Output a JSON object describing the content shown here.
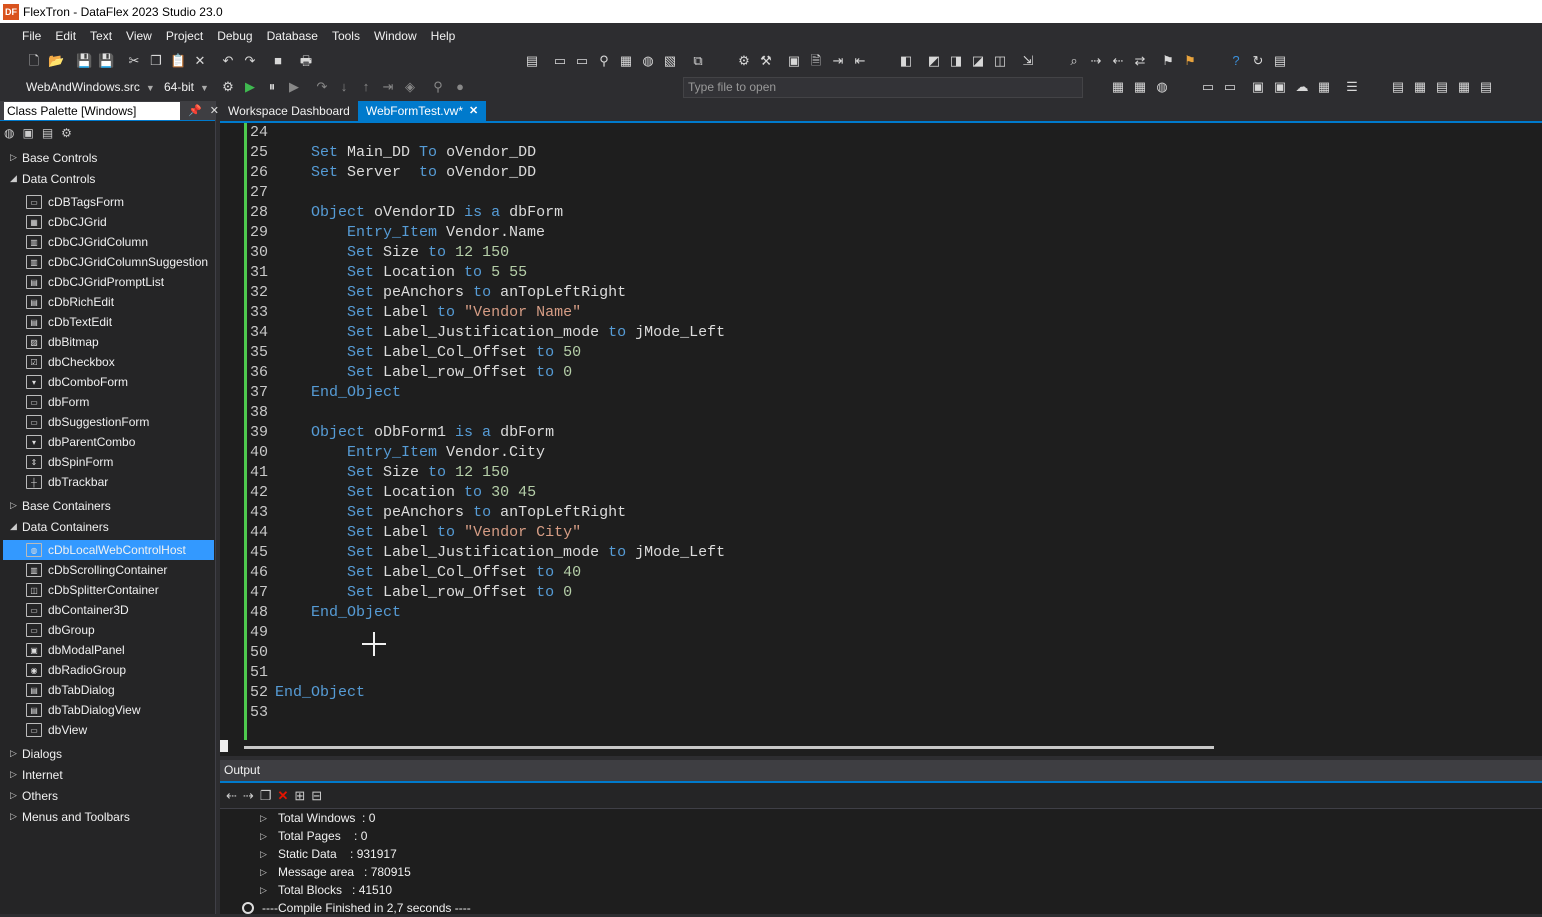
{
  "window": {
    "title": "FlexTron - DataFlex 2023 Studio 23.0",
    "app_icon": "DF"
  },
  "menu": [
    "File",
    "Edit",
    "Text",
    "View",
    "Project",
    "Debug",
    "Database",
    "Tools",
    "Window",
    "Help"
  ],
  "toolbar": {
    "workspace_combo": "WebAndWindows.src",
    "bitness_combo": "64-bit",
    "type_file_placeholder": "Type file to open"
  },
  "palette": {
    "title": "Class Palette [Windows]",
    "groups": [
      {
        "label": "Base Controls",
        "expanded": false
      },
      {
        "label": "Data Controls",
        "expanded": true,
        "items": [
          "cDBTagsForm",
          "cDbCJGrid",
          "cDbCJGridColumn",
          "cDbCJGridColumnSuggestion",
          "cDbCJGridPromptList",
          "cDbRichEdit",
          "cDbTextEdit",
          "dbBitmap",
          "dbCheckbox",
          "dbComboForm",
          "dbForm",
          "dbSuggestionForm",
          "dbParentCombo",
          "dbSpinForm",
          "dbTrackbar"
        ]
      },
      {
        "label": "Base Containers",
        "expanded": false
      },
      {
        "label": "Data Containers",
        "expanded": true,
        "items": [
          "cDbLocalWebControlHost",
          "cDbScrollingContainer",
          "cDbSplitterContainer",
          "dbContainer3D",
          "dbGroup",
          "dbModalPanel",
          "dbRadioGroup",
          "dbTabDialog",
          "dbTabDialogView",
          "dbView"
        ]
      },
      {
        "label": "Dialogs",
        "expanded": false
      },
      {
        "label": "Internet",
        "expanded": false
      },
      {
        "label": "Others",
        "expanded": false
      },
      {
        "label": "Menus and Toolbars",
        "expanded": false
      }
    ],
    "selected_item": "cDbLocalWebControlHost"
  },
  "tabs": [
    {
      "label": "Workspace Dashboard",
      "active": false
    },
    {
      "label": "WebFormTest.vw*",
      "active": true
    }
  ],
  "editor": {
    "lines": [
      {
        "n": "24",
        "tokens": []
      },
      {
        "n": "25",
        "tokens": [
          [
            "    ",
            "txt"
          ],
          [
            "Set",
            "kw"
          ],
          [
            " Main_DD ",
            "txt"
          ],
          [
            "To",
            "kw"
          ],
          [
            " oVendor_DD",
            "txt"
          ]
        ]
      },
      {
        "n": "26",
        "tokens": [
          [
            "    ",
            "txt"
          ],
          [
            "Set",
            "kw"
          ],
          [
            " Server  ",
            "txt"
          ],
          [
            "to",
            "kw"
          ],
          [
            " oVendor_DD",
            "txt"
          ]
        ]
      },
      {
        "n": "27",
        "tokens": []
      },
      {
        "n": "28",
        "tokens": [
          [
            "    ",
            "txt"
          ],
          [
            "Object",
            "kw"
          ],
          [
            " oVendorID ",
            "txt"
          ],
          [
            "is a",
            "kw"
          ],
          [
            " dbForm",
            "txt"
          ]
        ]
      },
      {
        "n": "29",
        "tokens": [
          [
            "        ",
            "txt"
          ],
          [
            "Entry_Item",
            "kw"
          ],
          [
            " Vendor.Name",
            "txt"
          ]
        ]
      },
      {
        "n": "30",
        "tokens": [
          [
            "        ",
            "txt"
          ],
          [
            "Set",
            "kw"
          ],
          [
            " Size ",
            "txt"
          ],
          [
            "to",
            "kw"
          ],
          [
            " 12 150",
            "num"
          ]
        ]
      },
      {
        "n": "31",
        "tokens": [
          [
            "        ",
            "txt"
          ],
          [
            "Set",
            "kw"
          ],
          [
            " Location ",
            "txt"
          ],
          [
            "to",
            "kw"
          ],
          [
            " 5 55",
            "num"
          ]
        ]
      },
      {
        "n": "32",
        "tokens": [
          [
            "        ",
            "txt"
          ],
          [
            "Set",
            "kw"
          ],
          [
            " peAnchors ",
            "txt"
          ],
          [
            "to",
            "kw"
          ],
          [
            " anTopLeftRight",
            "txt"
          ]
        ]
      },
      {
        "n": "33",
        "tokens": [
          [
            "        ",
            "txt"
          ],
          [
            "Set",
            "kw"
          ],
          [
            " Label ",
            "txt"
          ],
          [
            "to",
            "kw"
          ],
          [
            " \"Vendor Name\"",
            "str"
          ]
        ]
      },
      {
        "n": "34",
        "tokens": [
          [
            "        ",
            "txt"
          ],
          [
            "Set",
            "kw"
          ],
          [
            " Label_Justification_mode ",
            "txt"
          ],
          [
            "to",
            "kw"
          ],
          [
            " jMode_Left",
            "txt"
          ]
        ]
      },
      {
        "n": "35",
        "tokens": [
          [
            "        ",
            "txt"
          ],
          [
            "Set",
            "kw"
          ],
          [
            " Label_Col_Offset ",
            "txt"
          ],
          [
            "to",
            "kw"
          ],
          [
            " 50",
            "num"
          ]
        ]
      },
      {
        "n": "36",
        "tokens": [
          [
            "        ",
            "txt"
          ],
          [
            "Set",
            "kw"
          ],
          [
            " Label_row_Offset ",
            "txt"
          ],
          [
            "to",
            "kw"
          ],
          [
            " 0",
            "num"
          ]
        ]
      },
      {
        "n": "37",
        "tokens": [
          [
            "    ",
            "txt"
          ],
          [
            "End_Object",
            "kw"
          ]
        ]
      },
      {
        "n": "38",
        "tokens": []
      },
      {
        "n": "39",
        "tokens": [
          [
            "    ",
            "txt"
          ],
          [
            "Object",
            "kw"
          ],
          [
            " oDbForm1 ",
            "txt"
          ],
          [
            "is a",
            "kw"
          ],
          [
            " dbForm",
            "txt"
          ]
        ]
      },
      {
        "n": "40",
        "tokens": [
          [
            "        ",
            "txt"
          ],
          [
            "Entry_Item",
            "kw"
          ],
          [
            " Vendor.City",
            "txt"
          ]
        ]
      },
      {
        "n": "41",
        "tokens": [
          [
            "        ",
            "txt"
          ],
          [
            "Set",
            "kw"
          ],
          [
            " Size ",
            "txt"
          ],
          [
            "to",
            "kw"
          ],
          [
            " 12 150",
            "num"
          ]
        ]
      },
      {
        "n": "42",
        "tokens": [
          [
            "        ",
            "txt"
          ],
          [
            "Set",
            "kw"
          ],
          [
            " Location ",
            "txt"
          ],
          [
            "to",
            "kw"
          ],
          [
            " 30 45",
            "num"
          ]
        ]
      },
      {
        "n": "43",
        "tokens": [
          [
            "        ",
            "txt"
          ],
          [
            "Set",
            "kw"
          ],
          [
            " peAnchors ",
            "txt"
          ],
          [
            "to",
            "kw"
          ],
          [
            " anTopLeftRight",
            "txt"
          ]
        ]
      },
      {
        "n": "44",
        "tokens": [
          [
            "        ",
            "txt"
          ],
          [
            "Set",
            "kw"
          ],
          [
            " Label ",
            "txt"
          ],
          [
            "to",
            "kw"
          ],
          [
            " \"Vendor City\"",
            "str"
          ]
        ]
      },
      {
        "n": "45",
        "tokens": [
          [
            "        ",
            "txt"
          ],
          [
            "Set",
            "kw"
          ],
          [
            " Label_Justification_mode ",
            "txt"
          ],
          [
            "to",
            "kw"
          ],
          [
            " jMode_Left",
            "txt"
          ]
        ]
      },
      {
        "n": "46",
        "tokens": [
          [
            "        ",
            "txt"
          ],
          [
            "Set",
            "kw"
          ],
          [
            " Label_Col_Offset ",
            "txt"
          ],
          [
            "to",
            "kw"
          ],
          [
            " 40",
            "num"
          ]
        ]
      },
      {
        "n": "47",
        "tokens": [
          [
            "        ",
            "txt"
          ],
          [
            "Set",
            "kw"
          ],
          [
            " Label_row_Offset ",
            "txt"
          ],
          [
            "to",
            "kw"
          ],
          [
            " 0",
            "num"
          ]
        ]
      },
      {
        "n": "48",
        "tokens": [
          [
            "    ",
            "txt"
          ],
          [
            "End_Object",
            "kw"
          ]
        ]
      },
      {
        "n": "49",
        "tokens": []
      },
      {
        "n": "50",
        "tokens": []
      },
      {
        "n": "51",
        "tokens": []
      },
      {
        "n": "52",
        "tokens": [
          [
            "End_Object",
            "kw"
          ]
        ]
      },
      {
        "n": "53",
        "tokens": []
      }
    ]
  },
  "output": {
    "title": "Output",
    "lines": [
      "Total Windows  : 0",
      "Total Pages    : 0",
      "Static Data    : 931917",
      "Message area   : 780915",
      "Total Blocks   : 41510"
    ],
    "final_line": "----Compile Finished in 2,7 seconds ----"
  },
  "colors": {
    "accent": "#007acc",
    "selected": "#3399ff",
    "keyword": "#569cd6",
    "string": "#d69d85",
    "number": "#b5cea8"
  }
}
